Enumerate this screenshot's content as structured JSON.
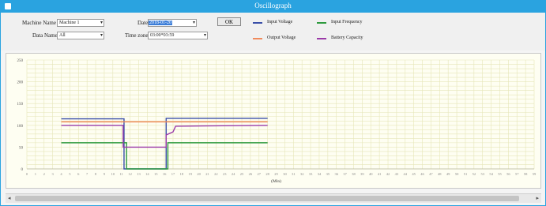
{
  "window": {
    "title": "Oscillograph"
  },
  "filters": {
    "machine_name_label": "Machine Name",
    "machine_name_value": "Machine 1",
    "data_name_label": "Data Name",
    "data_name_value": "All",
    "date_label": "Date",
    "date_value": "2018-01-20",
    "time_zone_label": "Time zone",
    "time_zone_value": "03:00*03:59",
    "ok_label": "OK"
  },
  "colors": {
    "input_voltage": "#3a4fa8",
    "output_voltage": "#f08a5c",
    "input_frequency": "#2e9a3e",
    "battery_capacity": "#9a3aa8",
    "grid": "#e6e6b8"
  },
  "chart_data": {
    "type": "line",
    "title": "",
    "xlabel": "(Min)",
    "ylabel": "",
    "xlim": [
      0,
      59
    ],
    "ylim": [
      0,
      250
    ],
    "x_ticks": [
      0,
      1,
      2,
      3,
      4,
      5,
      6,
      7,
      8,
      9,
      10,
      11,
      12,
      13,
      14,
      15,
      16,
      17,
      18,
      19,
      20,
      21,
      22,
      23,
      24,
      25,
      26,
      27,
      28,
      29,
      30,
      31,
      32,
      33,
      34,
      35,
      36,
      37,
      38,
      39,
      40,
      41,
      42,
      43,
      44,
      45,
      46,
      47,
      48,
      49,
      50,
      51,
      52,
      53,
      54,
      55,
      56,
      57,
      58,
      59
    ],
    "y_ticks": [
      0,
      50,
      100,
      150,
      200,
      250
    ],
    "grid": true,
    "series": [
      {
        "name": "Input Voltage",
        "color": "#3a4fa8",
        "x": [
          4,
          11.3,
          11.3,
          16.2,
          16.2,
          28
        ],
        "y": [
          115,
          115,
          0,
          0,
          116,
          116
        ]
      },
      {
        "name": "Output Voltage",
        "color": "#f08a5c",
        "x": [
          4,
          28
        ],
        "y": [
          108,
          108
        ]
      },
      {
        "name": "Input Frequency",
        "color": "#2e9a3e",
        "x": [
          4,
          11.6,
          11.6,
          16.4,
          16.4,
          28
        ],
        "y": [
          60,
          60,
          0,
          0,
          60,
          60
        ]
      },
      {
        "name": "Battery Capacity",
        "color": "#9a3aa8",
        "x": [
          4,
          11.2,
          11.2,
          16.2,
          16.2,
          17,
          17.3,
          28
        ],
        "y": [
          100,
          100,
          50,
          50,
          78,
          85,
          98,
          100
        ]
      }
    ]
  }
}
